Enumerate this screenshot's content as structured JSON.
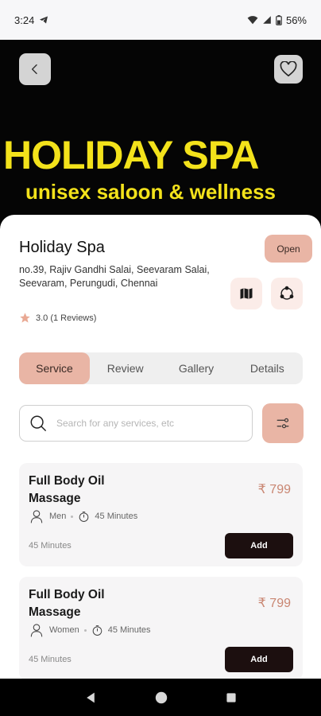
{
  "status_bar": {
    "time": "3:24",
    "battery": "56%"
  },
  "hero": {
    "title": "HOLIDAY SPA",
    "subtitle": "unisex saloon & wellness"
  },
  "shop": {
    "name": "Holiday Spa",
    "status": "Open",
    "address": "no.39, Rajiv Gandhi Salai, Seevaram Salai, Seevaram, Perungudi, Chennai",
    "rating": "3.0 (1 Reviews)"
  },
  "tabs": [
    {
      "label": "Service"
    },
    {
      "label": "Review"
    },
    {
      "label": "Gallery"
    },
    {
      "label": "Details"
    }
  ],
  "search": {
    "placeholder": "Search for any services, etc"
  },
  "services": [
    {
      "name": "Full Body Oil Massage",
      "price": "₹ 799",
      "gender": "Men",
      "duration_meta": "45 Minutes",
      "duration": "45 Minutes",
      "add_label": "Add"
    },
    {
      "name": "Full Body Oil Massage",
      "price": "₹ 799",
      "gender": "Women",
      "duration_meta": "45 Minutes",
      "duration": "45 Minutes",
      "add_label": "Add"
    }
  ],
  "icons": {
    "back": "chevron-left-icon",
    "favorite": "heart-icon",
    "map": "map-icon",
    "share": "share-icon",
    "star": "star-icon",
    "search": "search-icon",
    "filter": "filter-icon",
    "person": "person-icon",
    "timer": "timer-icon"
  },
  "colors": {
    "accent": "#e9b5a5",
    "price": "#c98672",
    "hero_text": "#f3e21b",
    "button_dark": "#1c0f0f"
  }
}
